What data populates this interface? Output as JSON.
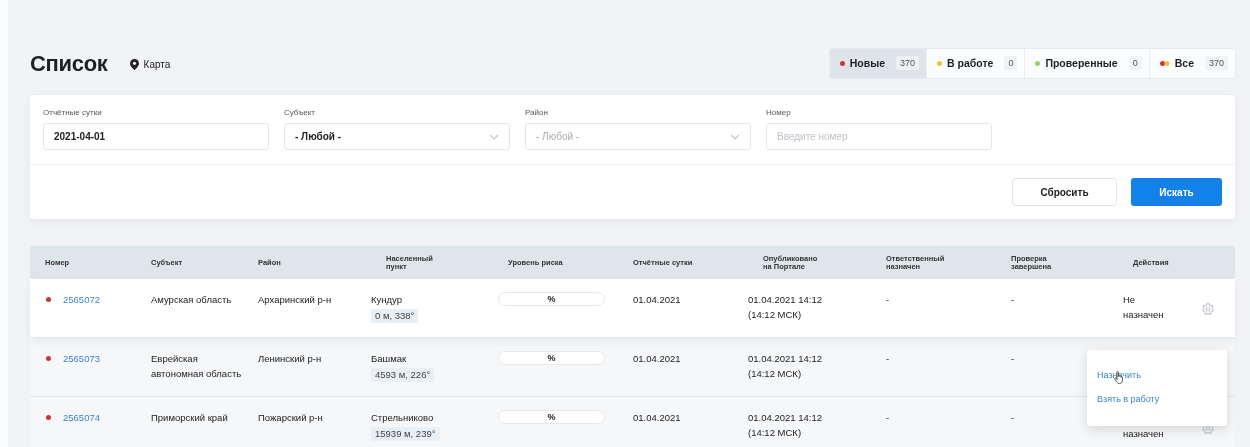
{
  "header": {
    "title": "Список",
    "map_link": "Карта"
  },
  "status_tabs": [
    {
      "label": "Новые",
      "count": "370",
      "selected": true,
      "kind": "status",
      "color": "#c8353b"
    },
    {
      "label": "В работе",
      "count": "0",
      "selected": false,
      "kind": "status",
      "color": "#efc23a"
    },
    {
      "label": "Проверенные",
      "count": "0",
      "selected": false,
      "kind": "status",
      "color": "#9ccf6a"
    },
    {
      "label": "Все",
      "count": "370",
      "selected": false,
      "kind": "all"
    }
  ],
  "filters": [
    {
      "label": "Отчётные сутки",
      "kind": "input",
      "value": "2021-04-01",
      "disabled": false
    },
    {
      "label": "Субъект",
      "kind": "select",
      "value": "- Любой -",
      "disabled": false
    },
    {
      "label": "Район",
      "kind": "select",
      "value": "- Любой -",
      "disabled": true
    },
    {
      "label": "Номер",
      "kind": "input",
      "placeholder": "Введите номер"
    }
  ],
  "buttons": {
    "reset": "Сбросить",
    "search": "Искать"
  },
  "table": {
    "columns": [
      "Номер",
      "Субъект",
      "Район",
      "Населенный пункт",
      "Уровень риска",
      "Отчётные сутки",
      "Опубликовано на Портале",
      "Ответственный назначен",
      "Проверка завершена",
      "Действия"
    ],
    "rows": [
      {
        "highlighted": true,
        "color": "#c8353b",
        "number": "2565072",
        "subject": "Амурская область",
        "district": "Архаринский р-н",
        "locality": "Кундур",
        "distance": "0 м, 338°",
        "risk": "%",
        "level": 0,
        "date": "01.04.2021",
        "published": [
          "01.04.2021 14:12",
          "(14:12 МСК)"
        ],
        "responsible": "-",
        "check": "-",
        "action": [
          "Не",
          "назначен"
        ],
        "settings_icon": true
      },
      {
        "highlighted": false,
        "color": "#c8353b",
        "number": "2565073",
        "subject": "Еврейская автономная область",
        "district": "Ленинский р-н",
        "locality": "Башмак",
        "distance": "4593 м, 226°",
        "risk": "%",
        "level": 0,
        "date": "01.04.2021",
        "published": [
          "01.04.2021 14:12",
          "(14:12 МСК)"
        ],
        "responsible": "-",
        "check": "-",
        "action": []
      },
      {
        "highlighted": false,
        "color": "#c8353b",
        "number": "2565074",
        "subject": "Приморский край",
        "district": "Пожарский р-н",
        "locality": "Стрельниково",
        "distance": "15939 м, 239°",
        "risk": "%",
        "level": 0,
        "date": "01.04.2021",
        "published": [
          "01.04.2021 14:12",
          "(14:12 МСК)"
        ],
        "responsible": "-",
        "check": "-",
        "action": [
          "назначен"
        ],
        "settings_icon": true
      }
    ]
  },
  "action_menu": {
    "items": [
      "Назначить",
      "Взять в работу"
    ]
  }
}
